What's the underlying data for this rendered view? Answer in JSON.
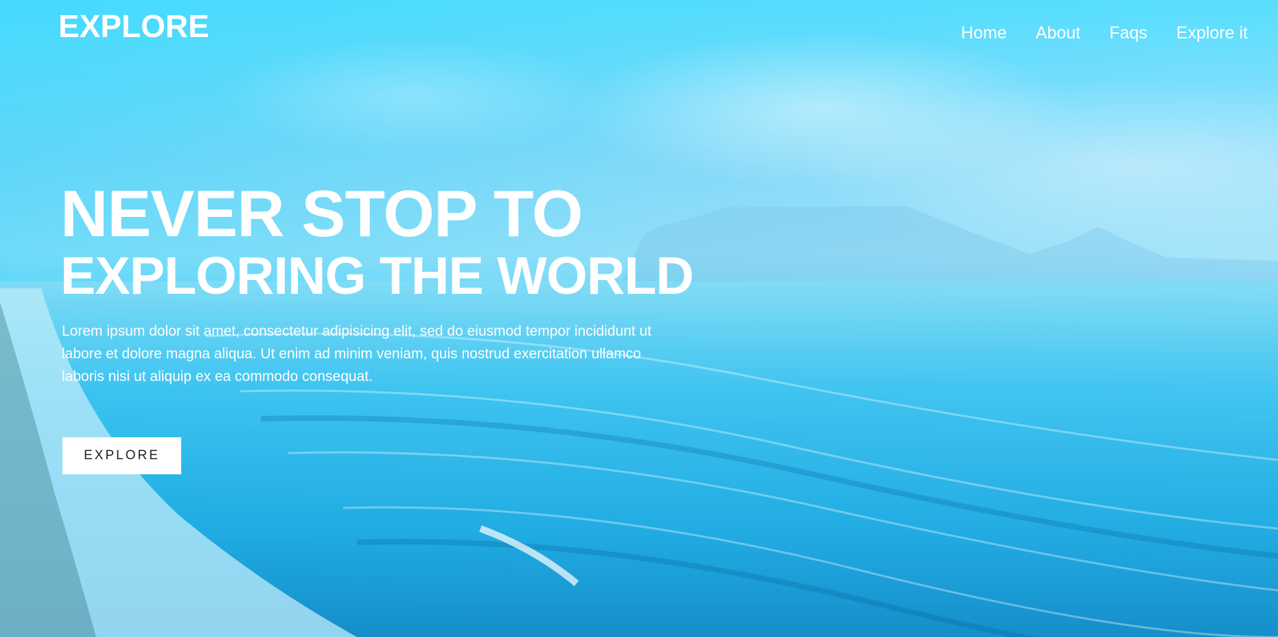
{
  "brand": {
    "logo_text": "EXPLORE"
  },
  "nav": {
    "items": [
      {
        "label": "Home"
      },
      {
        "label": "About"
      },
      {
        "label": "Faqs"
      },
      {
        "label": "Explore it"
      }
    ]
  },
  "hero": {
    "headline_line1": "NEVER STOP TO",
    "headline_line2": "EXPLORING THE WORLD",
    "description": "Lorem ipsum dolor sit amet, consectetur adipisicing elit, sed do eiusmod tempor incididunt ut labore et dolore magna aliqua. Ut enim ad minim veniam, quis nostrud exercitation ullamco laboris nisi ut aliquip ex ea commodo consequat.",
    "cta_label": "EXPLORE"
  },
  "colors": {
    "accent": "#3fd4f8",
    "text": "#ffffff",
    "button_bg": "#ffffff",
    "button_text": "#222222"
  }
}
